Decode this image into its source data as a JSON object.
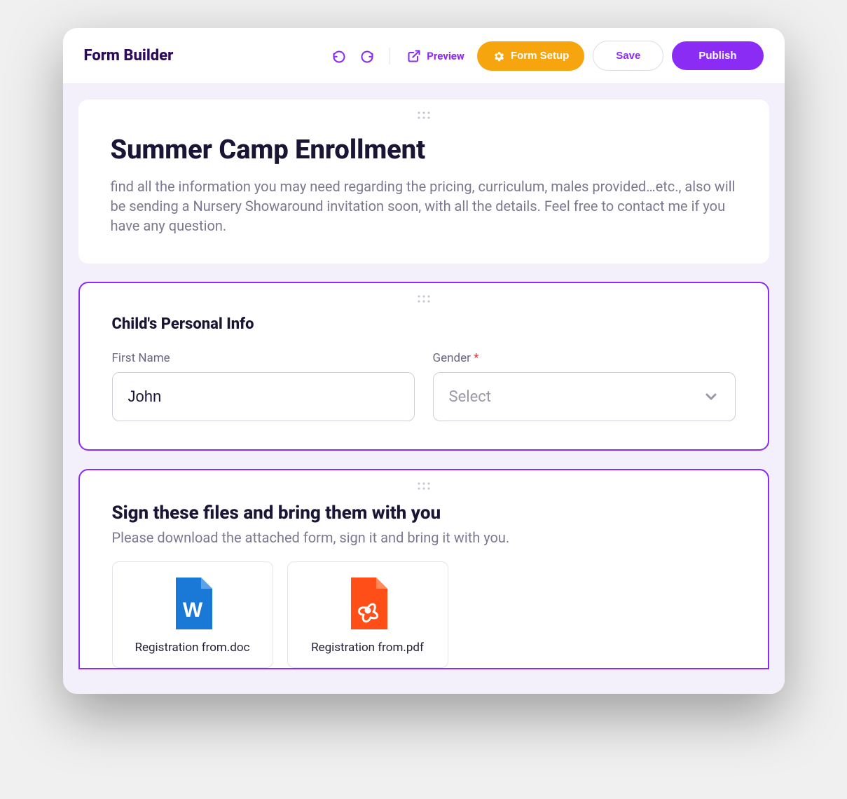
{
  "toolbar": {
    "title": "Form Builder",
    "preview_label": "Preview",
    "setup_label": "Form Setup",
    "save_label": "Save",
    "publish_label": "Publish"
  },
  "header_card": {
    "title": "Summer Camp Enrollment",
    "description": "find all the information you may need regarding the pricing, curriculum, males provided…etc., also will be sending a Nursery Showaround invitation soon, with all the details. Feel free to contact me if you have any question."
  },
  "personal_info": {
    "title": "Child's Personal Info",
    "fields": {
      "first_name": {
        "label": "First Name",
        "value": "John"
      },
      "gender": {
        "label": "Gender",
        "required_mark": "*",
        "placeholder": "Select"
      }
    }
  },
  "files_section": {
    "title": "Sign these files and bring them with you",
    "description": "Please download the attached form, sign it and bring it with you.",
    "files": [
      {
        "name": "Registration from.doc",
        "type": "doc"
      },
      {
        "name": "Registration from.pdf",
        "type": "pdf"
      }
    ]
  },
  "colors": {
    "accent": "#8b2cf5",
    "warning": "#f7a50e",
    "doc": "#1a78d6",
    "pdf": "#ff4e17"
  }
}
